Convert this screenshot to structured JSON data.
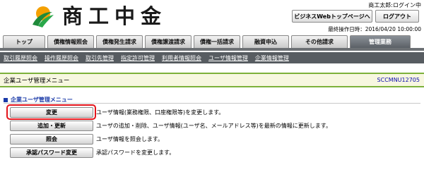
{
  "header": {
    "brand": "商工中金",
    "user_greeting": "商工太郎:ログイン中",
    "top_page_button": "ビジネスWebトップページへ",
    "logout_button": "ログアウト",
    "last_login": "最終操作日時：2016/04/20 10:00:00"
  },
  "tabs": [
    {
      "label": "トップ",
      "active": false
    },
    {
      "label": "債権情報照会",
      "active": false
    },
    {
      "label": "債権発生請求",
      "active": false
    },
    {
      "label": "債権譲渡請求",
      "active": false
    },
    {
      "label": "債権一括請求",
      "active": false
    },
    {
      "label": "融資申込",
      "active": false
    },
    {
      "label": "その他請求",
      "active": false
    },
    {
      "label": "管理業務",
      "active": true
    }
  ],
  "subnav": [
    "取引履歴照会",
    "操作履歴照会",
    "取引先管理",
    "指定許可管理",
    "利用者情報照会",
    "ユーザ情報管理",
    "企業情報管理"
  ],
  "page": {
    "title": "企業ユーザ管理メニュー",
    "screen_id": "SCCMNU12705"
  },
  "section": {
    "heading": "企業ユーザ管理メニュー",
    "items": [
      {
        "button": "変更",
        "description": "ユーザ情報(業務権限、口座権限等)を変更します。"
      },
      {
        "button": "追加・更新",
        "description": "ユーザの追加・削除、ユーザ情報(ユーザ名、メールアドレス等)を最新の情報に更新します。"
      },
      {
        "button": "照会",
        "description": "ユーザ情報を照会します。"
      },
      {
        "button": "承認パスワード変更",
        "description": "承認パスワードを変更します。"
      }
    ]
  },
  "colors": {
    "accent_green": "#7db13b",
    "active_tab": "#5b6066",
    "subnav_bg": "#575c61",
    "highlight": "#e3141b",
    "heading_blue": "#1a3aa8"
  }
}
